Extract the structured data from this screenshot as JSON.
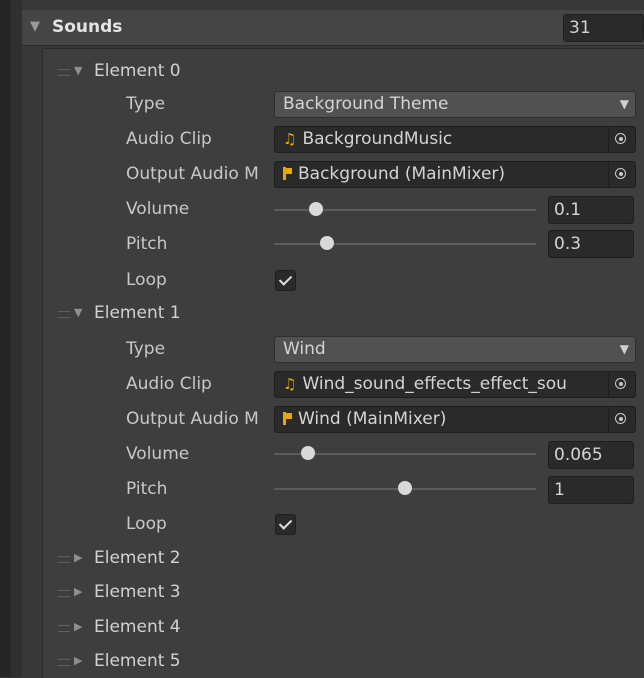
{
  "list": {
    "title": "Sounds",
    "count": "31"
  },
  "labels": {
    "type": "Type",
    "audio_clip": "Audio Clip",
    "output": "Output Audio M",
    "volume": "Volume",
    "pitch": "Pitch",
    "loop": "Loop"
  },
  "elements": [
    {
      "title": "Element 0",
      "type": "Background Theme",
      "audio_clip": "BackgroundMusic",
      "output": "Background (MainMixer)",
      "volume": "0.1",
      "volume_fraction": 0.1,
      "pitch": "0.3",
      "pitch_fraction": 0.15,
      "loop": true
    },
    {
      "title": "Element 1",
      "type": "Wind",
      "audio_clip": "Wind_sound_effects_effect_sou",
      "output": "Wind (MainMixer)",
      "volume": "0.065",
      "volume_fraction": 0.065,
      "pitch": "1",
      "pitch_fraction": 0.5,
      "loop": true
    }
  ],
  "collapsed_elements": [
    "Element 2",
    "Element 3",
    "Element 4",
    "Element 5"
  ],
  "colors": {
    "background": "#383838",
    "field": "#2a2a2a",
    "accent_icon": "#e8a800"
  },
  "icons": {
    "expanded": "triangle-down-icon",
    "collapsed": "triangle-right-icon",
    "audio_clip": "music-note-icon",
    "mixer": "audio-mixer-icon",
    "picker": "object-picker-icon"
  }
}
